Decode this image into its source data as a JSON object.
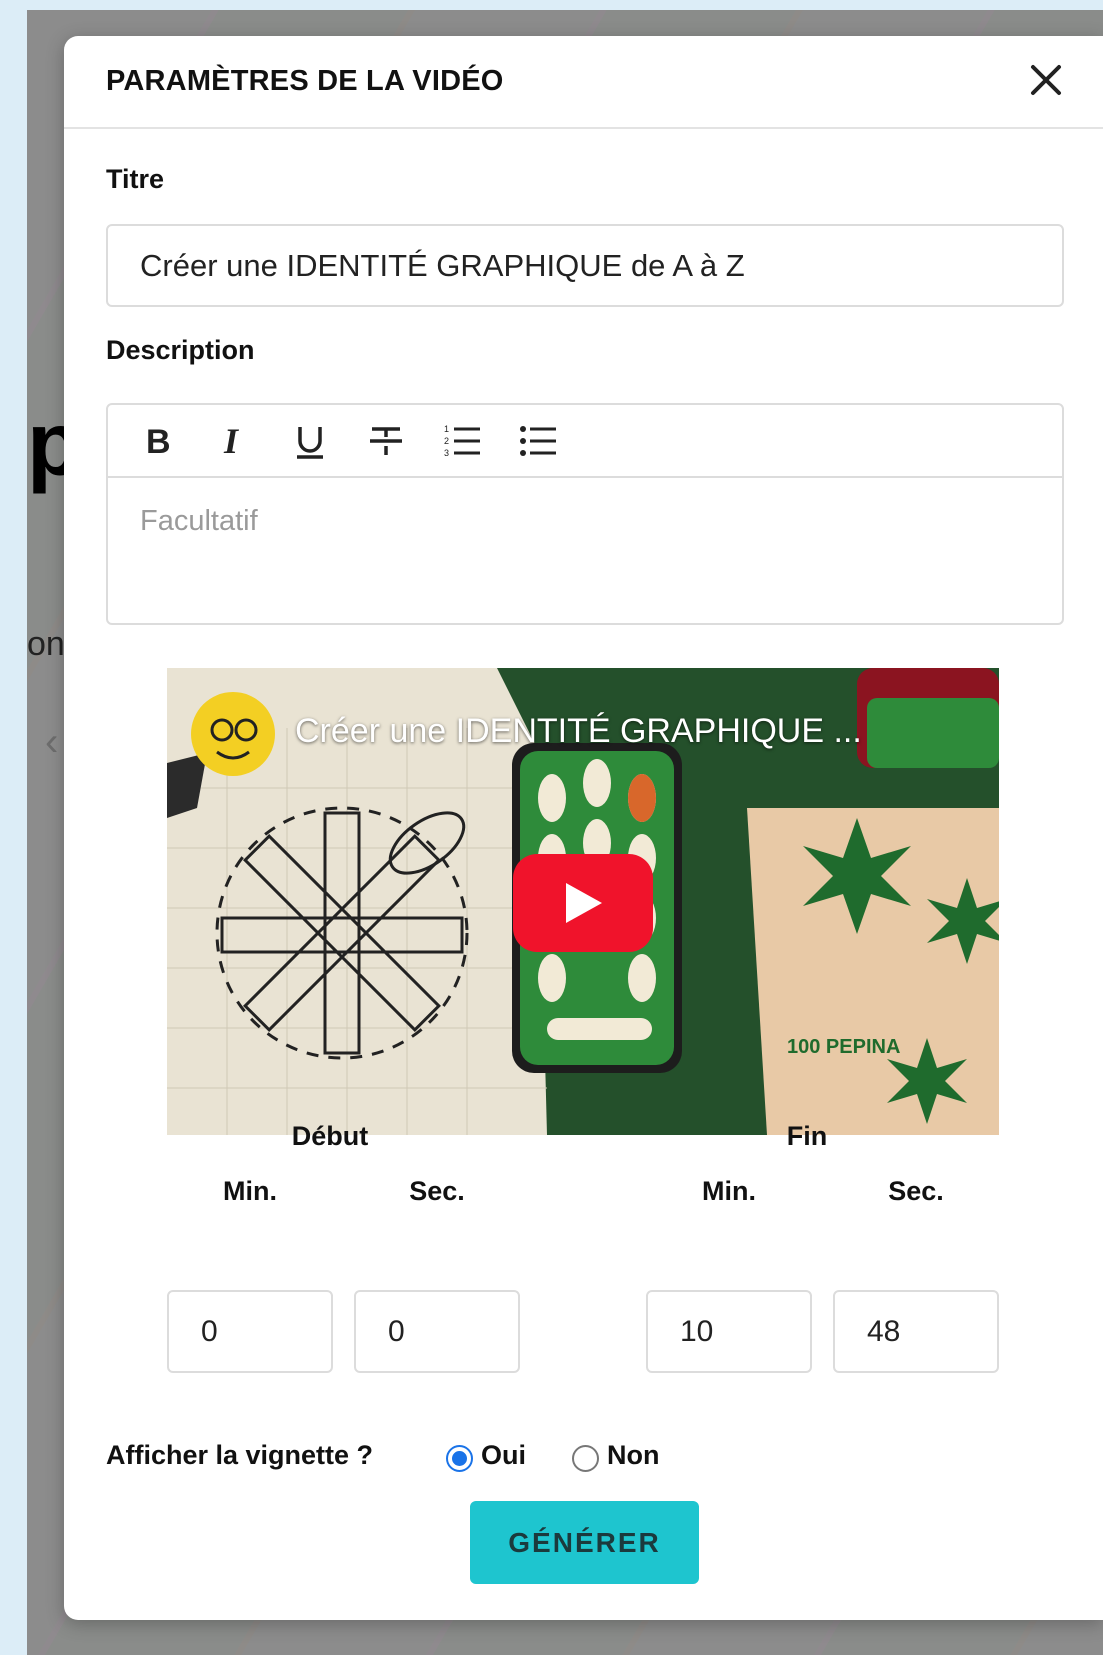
{
  "background": {
    "heading_fragment": "pi",
    "text_fragment": "on",
    "arrow": "‹"
  },
  "modal": {
    "title": "PARAMÈTRES DE LA VIDÉO",
    "close_icon": "close-icon"
  },
  "form": {
    "title_label": "Titre",
    "title_value": "Créer une IDENTITÉ GRAPHIQUE de A à Z",
    "description_label": "Description",
    "description_placeholder": "Facultatif",
    "toolbar": [
      {
        "name": "bold-icon",
        "label": "B"
      },
      {
        "name": "italic-icon",
        "label": "I"
      },
      {
        "name": "underline-icon",
        "label": "U"
      },
      {
        "name": "strikethrough-icon",
        "label": "S"
      },
      {
        "name": "ordered-list-icon",
        "label": "1."
      },
      {
        "name": "bullet-list-icon",
        "label": "•"
      }
    ]
  },
  "video": {
    "title": "Créer une IDENTITÉ GRAPHIQUE ...",
    "play_icon": "play-icon",
    "brand_text": "100 PEPINA"
  },
  "timing": {
    "start_label": "Début",
    "end_label": "Fin",
    "min_label": "Min.",
    "sec_label": "Sec.",
    "start_min": "0",
    "start_sec": "0",
    "end_min": "10",
    "end_sec": "48"
  },
  "thumbnail": {
    "question": "Afficher la vignette ?",
    "options": [
      {
        "label": "Oui",
        "checked": true
      },
      {
        "label": "Non",
        "checked": false
      }
    ]
  },
  "actions": {
    "generate_label": "GÉNÉRER"
  },
  "colors": {
    "accent": "#1ec5cf",
    "radio": "#1a73e8",
    "play": "#f0132b"
  }
}
